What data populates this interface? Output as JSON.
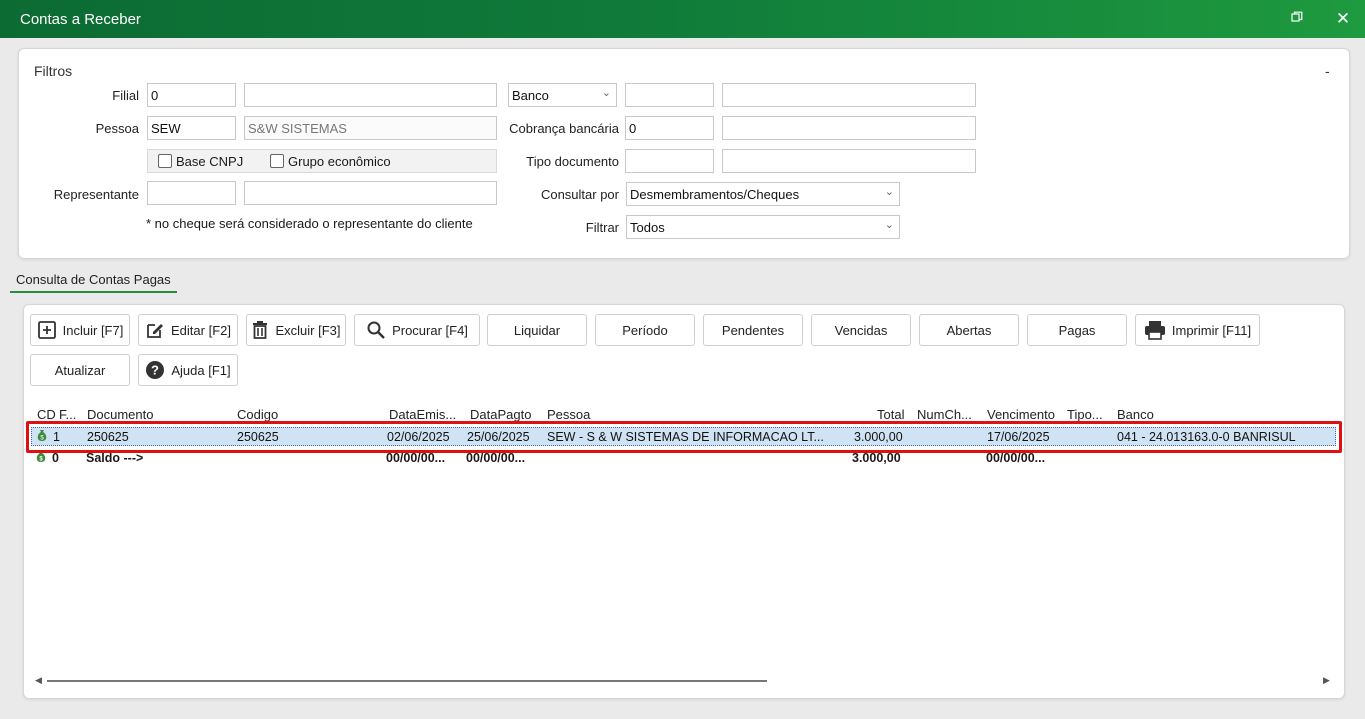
{
  "window": {
    "title": "Contas a Receber"
  },
  "filters": {
    "title": "Filtros",
    "collapse": "-",
    "filial": {
      "label": "Filial",
      "code": "0",
      "name": ""
    },
    "pessoa": {
      "label": "Pessoa",
      "code": "SEW",
      "name": "S&W SISTEMAS"
    },
    "base_cnpj": "Base CNPJ",
    "grupo_economico": "Grupo econômico",
    "representante": {
      "label": "Representante",
      "code": "",
      "name": ""
    },
    "note": "* no cheque será considerado o representante do cliente",
    "banco": {
      "label": "Banco",
      "code": "",
      "name": ""
    },
    "cobranca": {
      "label": "Cobrança bancária",
      "code": "0",
      "name": ""
    },
    "tipo_documento": {
      "label": "Tipo documento",
      "code": "",
      "name": ""
    },
    "consultar_por": {
      "label": "Consultar por",
      "value": "Desmembramentos/Cheques"
    },
    "filtrar": {
      "label": "Filtrar",
      "value": "Todos"
    }
  },
  "tab": {
    "label": "Consulta de Contas Pagas"
  },
  "toolbar": {
    "incluir": "Incluir [F7]",
    "editar": "Editar [F2]",
    "excluir": "Excluir [F3]",
    "procurar": "Procurar [F4]",
    "liquidar": "Liquidar",
    "periodo": "Período",
    "pendentes": "Pendentes",
    "vencidas": "Vencidas",
    "abertas": "Abertas",
    "pagas": "Pagas",
    "imprimir": "Imprimir [F11]",
    "atualizar": "Atualizar",
    "ajuda": "Ajuda [F1]"
  },
  "grid": {
    "headers": {
      "cd": "CD",
      "f": "F...",
      "documento": "Documento",
      "codigo": "Codigo",
      "data_emissao": "DataEmis...",
      "data_pagto": "DataPagto",
      "pessoa": "Pessoa",
      "total": "Total",
      "num_cheque": "NumCh...",
      "vencimento": "Vencimento",
      "tipo": "Tipo...",
      "banco": "Banco"
    },
    "rows": [
      {
        "cd": "1",
        "documento": "250625",
        "codigo": "250625",
        "data_emissao": "02/06/2025",
        "data_pagto": "25/06/2025",
        "pessoa": "SEW - S & W SISTEMAS DE INFORMACAO LT...",
        "total": "3.000,00",
        "vencimento": "17/06/2025",
        "banco": "041 - 24.013163.0-0 BANRISUL"
      },
      {
        "cd": "0",
        "documento": "Saldo --->",
        "data_emissao": "00/00/00...",
        "data_pagto": "00/00/00...",
        "total": "3.000,00",
        "vencimento": "00/00/00..."
      }
    ]
  },
  "colors": {
    "titlebar_start": "#0c6b33",
    "titlebar_end": "#1e9a3f",
    "selection": "#cfe3f4",
    "highlight": "#e01010",
    "tab_underline": "#2b8a3e"
  },
  "icons": [
    "restore-icon",
    "close-icon",
    "plus-box-icon",
    "edit-icon",
    "trash-icon",
    "search-icon",
    "printer-icon",
    "help-icon",
    "money-bag-icon"
  ]
}
